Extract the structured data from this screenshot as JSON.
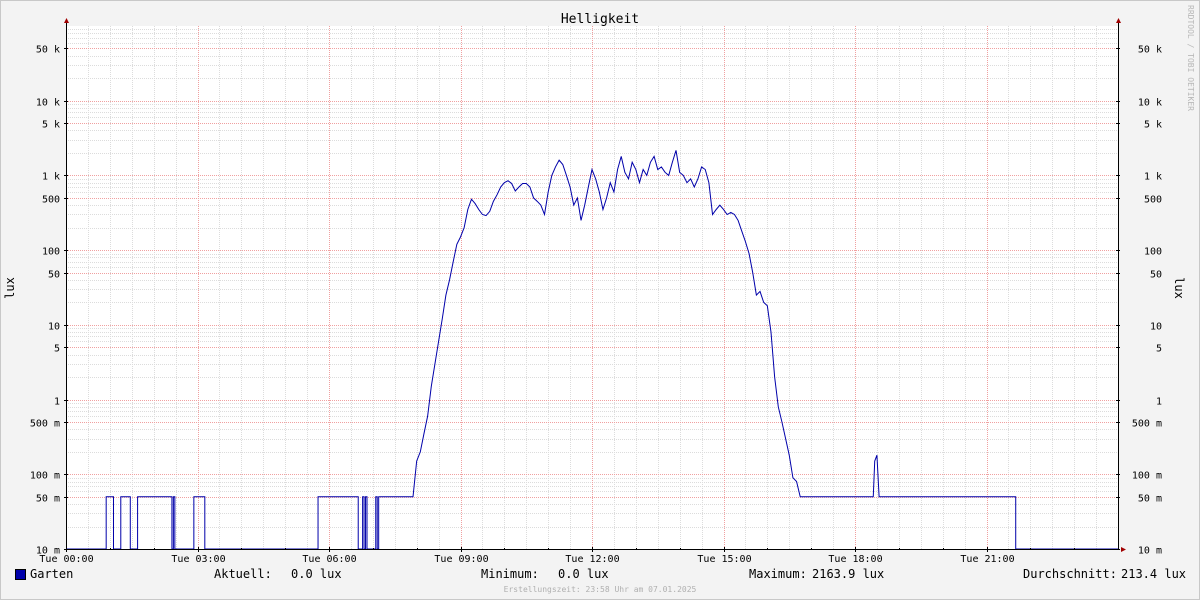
{
  "chart_data": {
    "type": "line",
    "title": "Helligkeit",
    "ylabel": "lux",
    "y_scale": "log",
    "ylim": [
      0.01,
      100000
    ],
    "xlim": [
      "00:00",
      "24:00"
    ],
    "x_ticks": [
      {
        "t": 0,
        "label": "Tue 00:00"
      },
      {
        "t": 3,
        "label": "Tue 03:00"
      },
      {
        "t": 6,
        "label": "Tue 06:00"
      },
      {
        "t": 9,
        "label": "Tue 09:00"
      },
      {
        "t": 12,
        "label": "Tue 12:00"
      },
      {
        "t": 15,
        "label": "Tue 15:00"
      },
      {
        "t": 18,
        "label": "Tue 18:00"
      },
      {
        "t": 21,
        "label": "Tue 21:00"
      }
    ],
    "y_ticks": [
      {
        "v": 0.01,
        "label": "10 m"
      },
      {
        "v": 0.05,
        "label": "50 m"
      },
      {
        "v": 0.1,
        "label": "100 m"
      },
      {
        "v": 0.5,
        "label": "500 m"
      },
      {
        "v": 1,
        "label": "1"
      },
      {
        "v": 5,
        "label": "5"
      },
      {
        "v": 10,
        "label": "10"
      },
      {
        "v": 50,
        "label": "50"
      },
      {
        "v": 100,
        "label": "100"
      },
      {
        "v": 500,
        "label": "500"
      },
      {
        "v": 1000,
        "label": "1 k"
      },
      {
        "v": 5000,
        "label": "5 k"
      },
      {
        "v": 10000,
        "label": "10 k"
      },
      {
        "v": 50000,
        "label": "50 k"
      }
    ],
    "grid": true,
    "series": [
      {
        "name": "Garten",
        "color": "#0000aa",
        "points": [
          [
            "00:00",
            0.01
          ],
          [
            "00:55",
            0.01
          ],
          [
            "00:55",
            0.05
          ],
          [
            "01:05",
            0.05
          ],
          [
            "01:05",
            0.01
          ],
          [
            "01:15",
            0.01
          ],
          [
            "01:15",
            0.05
          ],
          [
            "01:28",
            0.05
          ],
          [
            "01:28",
            0.01
          ],
          [
            "01:38",
            0.01
          ],
          [
            "01:38",
            0.05
          ],
          [
            "02:25",
            0.05
          ],
          [
            "02:25",
            0.01
          ],
          [
            "02:27",
            0.01
          ],
          [
            "02:27",
            0.05
          ],
          [
            "02:29",
            0.05
          ],
          [
            "02:29",
            0.01
          ],
          [
            "02:55",
            0.01
          ],
          [
            "02:55",
            0.05
          ],
          [
            "03:10",
            0.05
          ],
          [
            "03:10",
            0.01
          ],
          [
            "05:45",
            0.01
          ],
          [
            "05:45",
            0.05
          ],
          [
            "06:40",
            0.05
          ],
          [
            "06:40",
            0.01
          ],
          [
            "06:46",
            0.01
          ],
          [
            "06:46",
            0.05
          ],
          [
            "06:48",
            0.05
          ],
          [
            "06:48",
            0.01
          ],
          [
            "06:50",
            0.01
          ],
          [
            "06:50",
            0.05
          ],
          [
            "06:52",
            0.05
          ],
          [
            "06:52",
            0.01
          ],
          [
            "07:04",
            0.01
          ],
          [
            "07:04",
            0.05
          ],
          [
            "07:06",
            0.05
          ],
          [
            "07:06",
            0.01
          ],
          [
            "07:08",
            0.01
          ],
          [
            "07:08",
            0.05
          ],
          [
            "07:55",
            0.05
          ],
          [
            "08:00",
            0.15
          ],
          [
            "08:05",
            0.2
          ],
          [
            "08:10",
            0.35
          ],
          [
            "08:15",
            0.6
          ],
          [
            "08:20",
            1.5
          ],
          [
            "08:25",
            3
          ],
          [
            "08:30",
            6
          ],
          [
            "08:35",
            12
          ],
          [
            "08:40",
            25
          ],
          [
            "08:45",
            40
          ],
          [
            "08:50",
            70
          ],
          [
            "08:55",
            120
          ],
          [
            "09:00",
            150
          ],
          [
            "09:05",
            200
          ],
          [
            "09:10",
            350
          ],
          [
            "09:15",
            480
          ],
          [
            "09:20",
            420
          ],
          [
            "09:25",
            350
          ],
          [
            "09:30",
            300
          ],
          [
            "09:35",
            290
          ],
          [
            "09:40",
            330
          ],
          [
            "09:45",
            450
          ],
          [
            "09:50",
            550
          ],
          [
            "09:55",
            700
          ],
          [
            "10:00",
            800
          ],
          [
            "10:05",
            850
          ],
          [
            "10:10",
            780
          ],
          [
            "10:15",
            620
          ],
          [
            "10:20",
            700
          ],
          [
            "10:25",
            780
          ],
          [
            "10:30",
            780
          ],
          [
            "10:35",
            700
          ],
          [
            "10:40",
            500
          ],
          [
            "10:45",
            450
          ],
          [
            "10:50",
            400
          ],
          [
            "10:55",
            300
          ],
          [
            "11:00",
            600
          ],
          [
            "11:05",
            1000
          ],
          [
            "11:10",
            1300
          ],
          [
            "11:15",
            1600
          ],
          [
            "11:20",
            1400
          ],
          [
            "11:25",
            1000
          ],
          [
            "11:30",
            700
          ],
          [
            "11:35",
            400
          ],
          [
            "11:40",
            500
          ],
          [
            "11:45",
            250
          ],
          [
            "11:50",
            400
          ],
          [
            "11:55",
            700
          ],
          [
            "12:00",
            1200
          ],
          [
            "12:05",
            900
          ],
          [
            "12:10",
            600
          ],
          [
            "12:15",
            350
          ],
          [
            "12:20",
            500
          ],
          [
            "12:25",
            800
          ],
          [
            "12:30",
            600
          ],
          [
            "12:35",
            1200
          ],
          [
            "12:40",
            1800
          ],
          [
            "12:45",
            1100
          ],
          [
            "12:50",
            900
          ],
          [
            "12:55",
            1500
          ],
          [
            "13:00",
            1200
          ],
          [
            "13:05",
            800
          ],
          [
            "13:10",
            1200
          ],
          [
            "13:15",
            1000
          ],
          [
            "13:20",
            1500
          ],
          [
            "13:25",
            1800
          ],
          [
            "13:30",
            1200
          ],
          [
            "13:35",
            1300
          ],
          [
            "13:40",
            1100
          ],
          [
            "13:45",
            1000
          ],
          [
            "13:50",
            1500
          ],
          [
            "13:55",
            2163.9
          ],
          [
            "14:00",
            1100
          ],
          [
            "14:05",
            1000
          ],
          [
            "14:10",
            800
          ],
          [
            "14:15",
            900
          ],
          [
            "14:20",
            700
          ],
          [
            "14:25",
            900
          ],
          [
            "14:30",
            1300
          ],
          [
            "14:35",
            1200
          ],
          [
            "14:40",
            800
          ],
          [
            "14:45",
            300
          ],
          [
            "14:50",
            350
          ],
          [
            "14:55",
            400
          ],
          [
            "15:00",
            350
          ],
          [
            "15:05",
            300
          ],
          [
            "15:10",
            320
          ],
          [
            "15:15",
            300
          ],
          [
            "15:20",
            250
          ],
          [
            "15:25",
            180
          ],
          [
            "15:30",
            130
          ],
          [
            "15:35",
            90
          ],
          [
            "15:40",
            50
          ],
          [
            "15:45",
            25
          ],
          [
            "15:50",
            28
          ],
          [
            "15:55",
            20
          ],
          [
            "16:00",
            18
          ],
          [
            "16:05",
            8
          ],
          [
            "16:10",
            2
          ],
          [
            "16:15",
            0.8
          ],
          [
            "16:20",
            0.5
          ],
          [
            "16:25",
            0.3
          ],
          [
            "16:30",
            0.18
          ],
          [
            "16:35",
            0.09
          ],
          [
            "16:40",
            0.08
          ],
          [
            "16:45",
            0.05
          ],
          [
            "18:25",
            0.05
          ],
          [
            "18:27",
            0.15
          ],
          [
            "18:30",
            0.18
          ],
          [
            "18:33",
            0.05
          ],
          [
            "21:40",
            0.05
          ],
          [
            "21:40",
            0.01
          ],
          [
            "24:00",
            0.01
          ]
        ]
      }
    ],
    "legend": {
      "placement": "bottom-left"
    },
    "stats": {
      "current_label": "Aktuell:",
      "current_value": "0.0 lux",
      "minimum_label": "Minimum:",
      "minimum_value": "0.0 lux",
      "maximum_label": "Maximum:",
      "maximum_value": "2163.9 lux",
      "average_label": "Durchschnitt:",
      "average_value": "213.4 lux"
    },
    "side_credit": "RRDTOOL / TOBI OETIKER",
    "footer": "Erstellungszeit: 23:58 Uhr am 07.01.2025"
  }
}
